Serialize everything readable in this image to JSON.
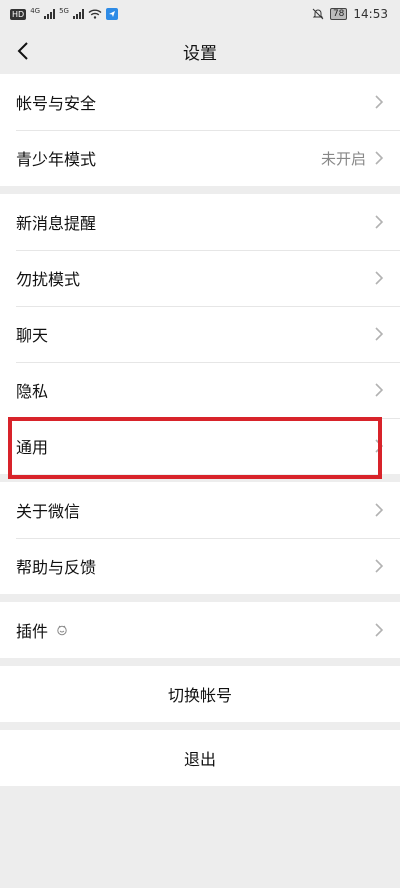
{
  "status_bar": {
    "hd_badge": "HD",
    "network_1": "4G",
    "network_2": "5G",
    "battery": "78",
    "time": "14:53"
  },
  "header": {
    "title": "设置"
  },
  "groups": [
    {
      "items": [
        {
          "label": "帐号与安全",
          "value": ""
        },
        {
          "label": "青少年模式",
          "value": "未开启"
        }
      ]
    },
    {
      "items": [
        {
          "label": "新消息提醒",
          "value": ""
        },
        {
          "label": "勿扰模式",
          "value": ""
        },
        {
          "label": "聊天",
          "value": ""
        },
        {
          "label": "隐私",
          "value": ""
        },
        {
          "label": "通用",
          "value": ""
        }
      ]
    },
    {
      "items": [
        {
          "label": "关于微信",
          "value": ""
        },
        {
          "label": "帮助与反馈",
          "value": ""
        }
      ]
    },
    {
      "items": [
        {
          "label": "插件",
          "value": ""
        }
      ]
    }
  ],
  "actions": {
    "switch_account": "切换帐号",
    "logout": "退出"
  },
  "colors": {
    "background": "#ededed",
    "highlight": "#d8232a"
  },
  "icons": [
    "back-arrow-icon",
    "chevron-right-icon",
    "plugin-icon",
    "wifi-icon",
    "mute-bell-icon",
    "battery-icon"
  ]
}
